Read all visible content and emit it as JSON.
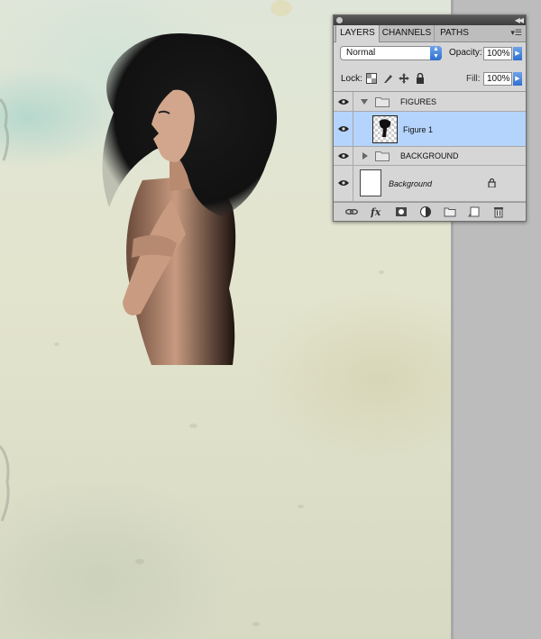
{
  "panel": {
    "tabs": [
      "LAYERS",
      "CHANNELS",
      "PATHS"
    ],
    "blend_mode": "Normal",
    "opacity_label": "Opacity:",
    "opacity_value": "100%",
    "lock_label": "Lock:",
    "fill_label": "Fill:",
    "fill_value": "100%"
  },
  "layers": [
    {
      "name": "FIGURES",
      "type": "group",
      "expanded": true,
      "visible": true
    },
    {
      "name": "Figure 1",
      "type": "layer",
      "selected": true,
      "visible": true
    },
    {
      "name": "BACKGROUND",
      "type": "group",
      "expanded": false,
      "visible": true
    },
    {
      "name": "Background",
      "type": "layer",
      "locked": true,
      "visible": true
    }
  ],
  "footer_icons": [
    "link-icon",
    "fx-icon",
    "layer-mask-icon",
    "adjustment-layer-icon",
    "new-group-icon",
    "new-layer-icon",
    "trash-icon"
  ],
  "colors": {
    "selection": "#b4d4fd",
    "panel_bg": "#d6d6d6",
    "accent": "#2f6fd0"
  }
}
